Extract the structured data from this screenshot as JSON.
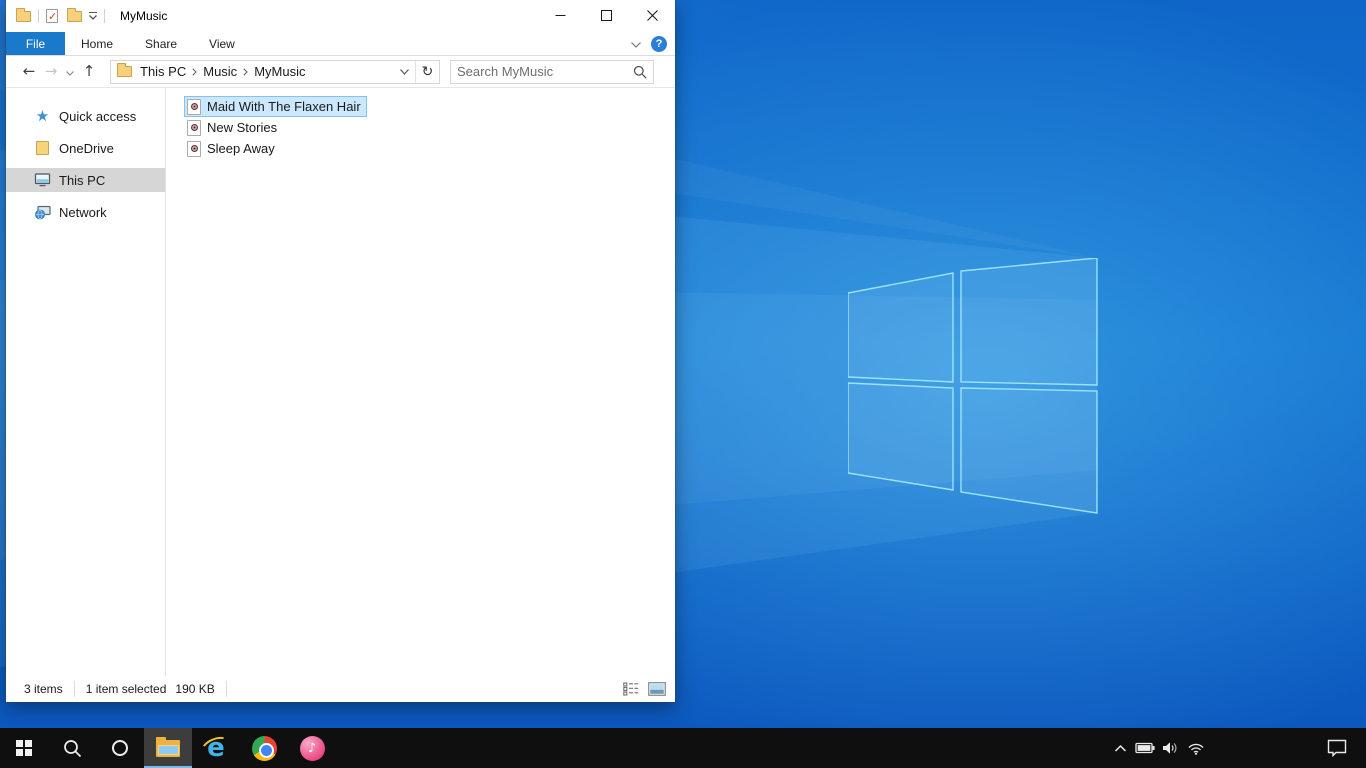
{
  "explorer": {
    "titlebar": {
      "title": "MyMusic"
    },
    "tabs": [
      {
        "label": "File"
      },
      {
        "label": "Home"
      },
      {
        "label": "Share"
      },
      {
        "label": "View"
      }
    ],
    "active_tab": "File",
    "navbar": {
      "breadcrumb": [
        {
          "label": "This PC"
        },
        {
          "label": "Music"
        },
        {
          "label": "MyMusic"
        }
      ],
      "search_placeholder": "Search MyMusic"
    },
    "sidebar": [
      {
        "label": "Quick access"
      },
      {
        "label": "OneDrive"
      },
      {
        "label": "This PC"
      },
      {
        "label": "Network"
      }
    ],
    "selected_sidebar_item": "This PC",
    "files": [
      {
        "name": "Maid With The Flaxen Hair"
      },
      {
        "name": "New Stories"
      },
      {
        "name": "Sleep Away"
      }
    ],
    "selected_file": "Maid With The Flaxen Hair",
    "status": {
      "count": "3 items",
      "selection": "1 item selected",
      "size": "190 KB"
    }
  },
  "taskbar": {
    "apps": [
      "start",
      "search",
      "cortana",
      "file-explorer",
      "internet-explorer",
      "chrome",
      "itunes"
    ],
    "active_app": "file-explorer",
    "tray": [
      "hidden-icons",
      "battery",
      "volume",
      "wifi",
      "action-center"
    ]
  },
  "glyphs": {
    "back": "←",
    "forward": "→",
    "up": "↑",
    "refresh": "↻",
    "star": "★",
    "note": "♪",
    "help": "?",
    "ie": "e"
  },
  "colors": {
    "tab_accent": "#1979ca",
    "file_selection_bg": "#cce8ff",
    "file_selection_border": "#84c3f0",
    "sidebar_selection": "#d6d6d6",
    "taskbar_bg": "#0f0f0f",
    "desktop_base": "#1273cf",
    "help_icon": "#2a7fd4"
  }
}
